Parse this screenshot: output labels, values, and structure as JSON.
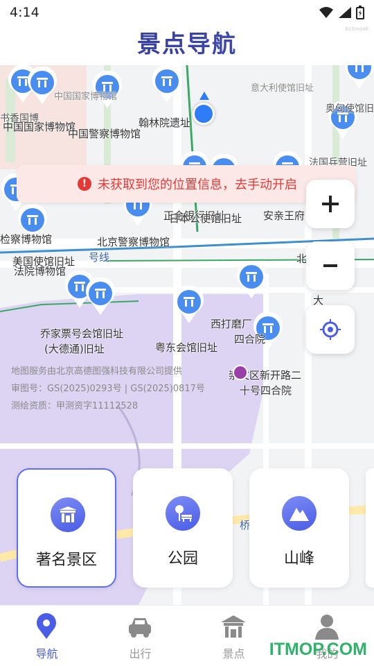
{
  "status": {
    "time": "4:14"
  },
  "header": {
    "title": "景点导航",
    "watermark": "910md46"
  },
  "toast": {
    "icon": "exclamation-circle-icon",
    "text": "未获取到您的位置信息，去手动开启"
  },
  "map": {
    "labels": [
      "中国国家博物馆",
      "书香国博",
      "中国国家博物馆",
      "中国警察博物馆",
      "翰林院遗址",
      "意大利使馆旧址",
      "奥匈使馆旧址",
      "法国兵营旧址",
      "正金银行旧址",
      "日本公使馆旧址",
      "安亲王府",
      "北京警察博物馆",
      "检察博物馆",
      "美国使馆旧址",
      "法院博物馆",
      "号线",
      "乔家票号会馆旧址",
      "(大德通)旧址",
      "粤东会馆旧址",
      "西打磨厂",
      "四合院",
      "崇文区新开路二",
      "十号四合院",
      "北京",
      "大",
      "桥"
    ],
    "credits": [
      "地图服务由北京高德图强科技有限公司提供",
      "审图号：GS(2025)0293号 | GS(2025)0817号",
      "测绘资质：甲测资字11112528"
    ]
  },
  "controls": {
    "zoom_in": "zoom-in-icon",
    "zoom_out": "zoom-out-icon",
    "locate": "locate-icon"
  },
  "categories": [
    {
      "label": "著名景区",
      "icon": "gate-icon",
      "active": true
    },
    {
      "label": "公园",
      "icon": "park-bench-icon",
      "active": false
    },
    {
      "label": "山峰",
      "icon": "mountain-icon",
      "active": false
    }
  ],
  "nav": [
    {
      "label": "导航",
      "icon": "location-pin-icon",
      "active": true
    },
    {
      "label": "出行",
      "icon": "car-icon",
      "active": false
    },
    {
      "label": "景点",
      "icon": "pavilion-icon",
      "active": false
    },
    {
      "label": "我的",
      "icon": "user-icon",
      "active": false
    }
  ],
  "site_watermark": "ITMOP.COM",
  "colors": {
    "accent": "#4a5de6",
    "toast_bg": "#fde8e8",
    "toast_text": "#e53935",
    "title": "#2b2f7a"
  }
}
